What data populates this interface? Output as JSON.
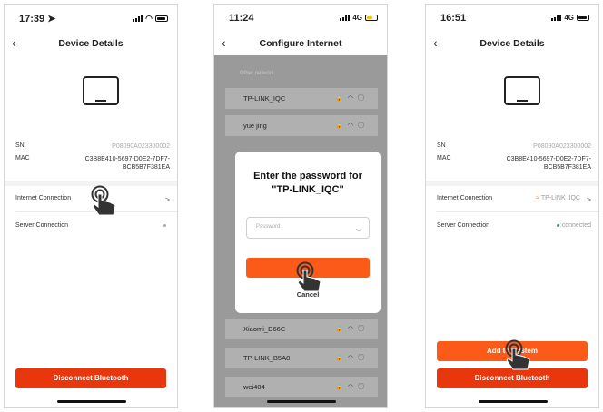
{
  "screen1": {
    "time": "17:39",
    "title": "Device Details",
    "sn_label": "SN",
    "sn_value": "P08090A023300002",
    "mac_label": "MAC",
    "mac_value": "C3B8E410-5697-D0E2-7DF7-BCB5B7F381EA",
    "internet_label": "Internet Connection",
    "internet_chevron": ">",
    "server_label": "Server Connection",
    "disconnect_label": "Disconnect Bluetooth"
  },
  "screen2": {
    "time": "11:24",
    "network_type": "4G",
    "title": "Configure Internet",
    "section_label": "Other network",
    "networks": [
      {
        "name": "TP-LINK_IQC"
      },
      {
        "name": "yue jing"
      },
      {
        "name": "Xiaomi_D66C"
      },
      {
        "name": "TP-LINK_B5A8"
      },
      {
        "name": "wei404"
      }
    ],
    "dialog": {
      "title": "Enter the password for \"TP-LINK_IQC\"",
      "password_placeholder": "Password",
      "cancel_label": "Cancel"
    }
  },
  "screen3": {
    "time": "16:51",
    "network_type": "4G",
    "title": "Device Details",
    "sn_label": "SN",
    "sn_value": "P08090A023300002",
    "mac_label": "MAC",
    "mac_value": "C3B8E410-5697-D0E2-7DF7-BCB5B7F381EA",
    "internet_label": "Internet Connection",
    "internet_value": "TP-LINK_IQC",
    "internet_chevron": ">",
    "server_label": "Server Connection",
    "server_value": "connected",
    "add_system_label": "Add to System",
    "disconnect_label": "Disconnect Bluetooth"
  },
  "colors": {
    "primary_button": "#e8360d",
    "accent_button": "#fb5a18",
    "connected_dot": "#2db35d",
    "wifi_icon": "#f6773e"
  },
  "icons": [
    "back-chevron-icon",
    "device-icon",
    "lock-icon",
    "wifi-icon",
    "info-icon",
    "tap-hand-icon",
    "eye-icon",
    "location-arrow-icon"
  ]
}
